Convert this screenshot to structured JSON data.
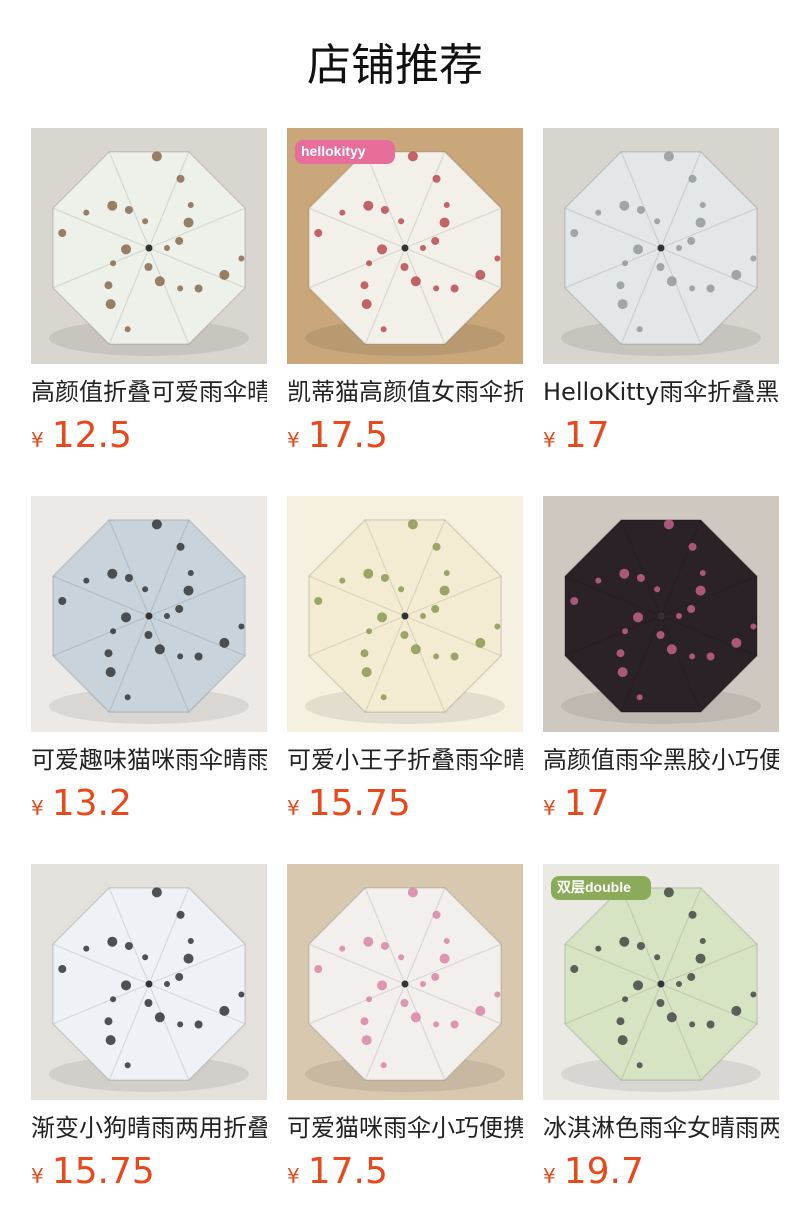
{
  "section": {
    "title": "店铺推荐"
  },
  "currency": "¥",
  "products": [
    {
      "name": "高颜值折叠可爱雨伞晴雨两用",
      "price": "12.5",
      "canopy": "#eef0ea",
      "accent": "#7a5a3a",
      "bg": "#d9d5cf"
    },
    {
      "name": "凯蒂猫高颜值女雨伞折叠",
      "price": "17.5",
      "canopy": "#f3efe9",
      "accent": "#b2363b",
      "bg": "#c9a77a",
      "badge": "hellokityy"
    },
    {
      "name": "HelloKitty雨伞折叠黑胶",
      "price": "17",
      "canopy": "#e3e7ea",
      "accent": "#8a8f92",
      "bg": "#d8d4ce"
    },
    {
      "name": "可爱趣味猫咪雨伞晴雨两用",
      "price": "13.2",
      "canopy": "#c8d3dc",
      "accent": "#222222",
      "bg": "#ece9e6"
    },
    {
      "name": "可爱小王子折叠雨伞晴雨",
      "price": "15.75",
      "canopy": "#f4ecd2",
      "accent": "#7f8e44",
      "bg": "#f6f0e0"
    },
    {
      "name": "高颜值雨伞黑胶小巧便携",
      "price": "17",
      "canopy": "#2a2226",
      "accent": "#d66a96",
      "bg": "#cfc8c0"
    },
    {
      "name": "渐变小狗晴雨两用折叠伞",
      "price": "15.75",
      "canopy": "#eef2f6",
      "accent": "#1a1a1a",
      "bg": "#e4e1dc"
    },
    {
      "name": "可爱猫咪雨伞小巧便携折叠",
      "price": "17.5",
      "canopy": "#f2efec",
      "accent": "#d6779f",
      "bg": "#d9c8b0"
    },
    {
      "name": "冰淇淋色雨伞女晴雨两用",
      "price": "19.7",
      "canopy": "#d7e4c3",
      "accent": "#333333",
      "bg": "#ebe9e4",
      "badge": "双层double"
    }
  ]
}
